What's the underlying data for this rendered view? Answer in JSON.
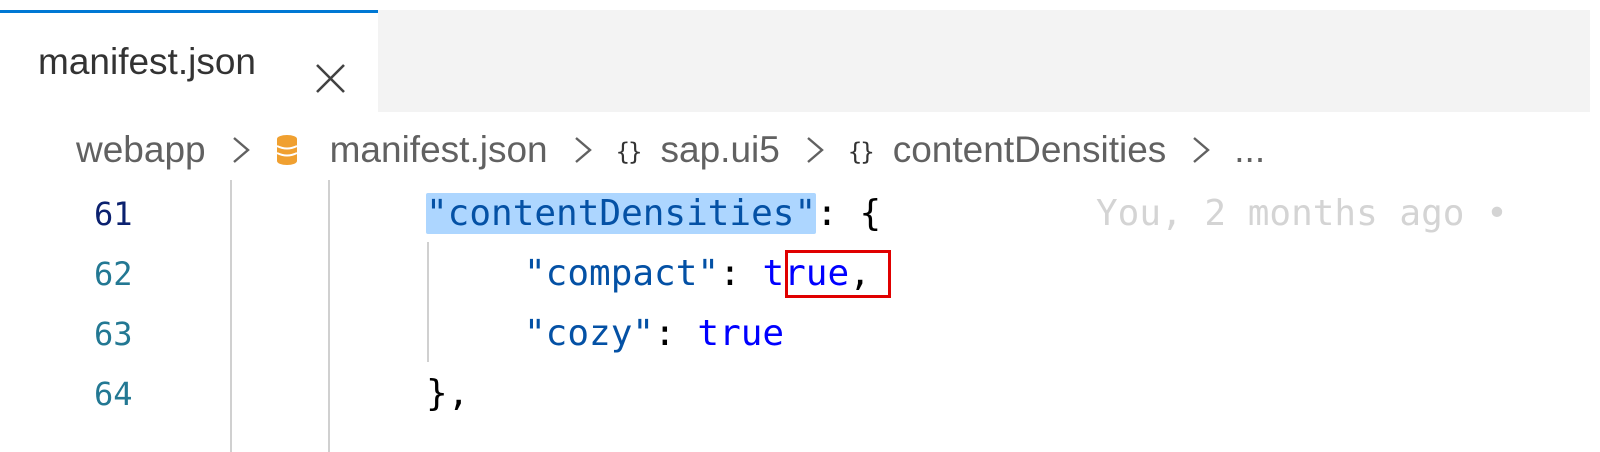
{
  "tabs": [
    {
      "label": "manifest.json",
      "active": true,
      "close_icon": "close-icon"
    }
  ],
  "breadcrumb": {
    "items": [
      {
        "label": "webapp",
        "icon": null
      },
      {
        "label": "manifest.json",
        "icon": "json-file-icon"
      },
      {
        "label": "sap.ui5",
        "icon": "object-braces-icon"
      },
      {
        "label": "contentDensities",
        "icon": "object-braces-icon"
      },
      {
        "label": "...",
        "icon": null
      }
    ],
    "separator_icon": "chevron-right-icon"
  },
  "editor": {
    "lines": [
      {
        "number": "61",
        "key": "\"contentDensities\"",
        "rest": ": {",
        "active": true,
        "blame": "You, 2 months ago •"
      },
      {
        "number": "62",
        "key": "\"compact\"",
        "colon": ": ",
        "value": "true",
        "trail": ","
      },
      {
        "number": "63",
        "key": "\"cozy\"",
        "colon": ": ",
        "value": "true",
        "trail": ""
      },
      {
        "number": "64",
        "text": "},"
      }
    ]
  },
  "colors": {
    "tab_active_border": "#0078d4",
    "line_number": "#237893",
    "json_key": "#0451a5",
    "json_boolean": "#0000ff",
    "selection": "#add6ff",
    "annotation_box": "#e00000",
    "json_file_icon": "#f0a030"
  }
}
